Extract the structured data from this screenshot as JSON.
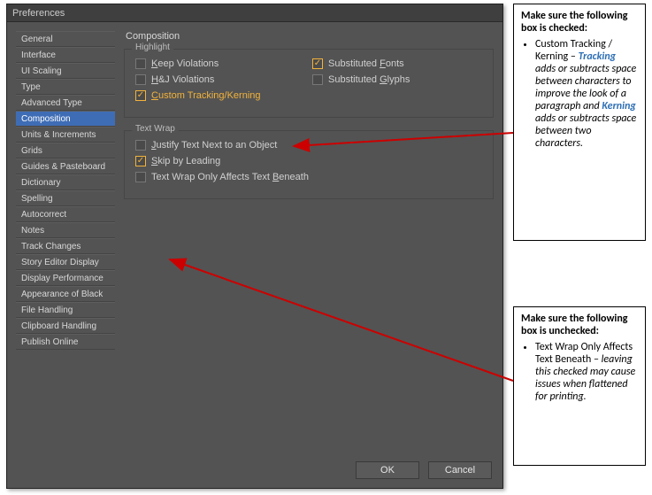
{
  "dialog": {
    "title": "Preferences",
    "sidebar": {
      "items": [
        "General",
        "Interface",
        "UI Scaling",
        "Type",
        "Advanced Type",
        "Composition",
        "Units & Increments",
        "Grids",
        "Guides & Pasteboard",
        "Dictionary",
        "Spelling",
        "Autocorrect",
        "Notes",
        "Track Changes",
        "Story Editor Display",
        "Display Performance",
        "Appearance of Black",
        "File Handling",
        "Clipboard Handling",
        "Publish Online"
      ],
      "selected": "Composition"
    },
    "content": {
      "heading": "Composition",
      "highlight": {
        "title": "Highlight",
        "keep_violations": "Keep Violations",
        "substituted_fonts": "Substituted Fonts",
        "hj_violations": "H&J Violations",
        "substituted_glyphs": "Substituted Glyphs",
        "custom_tracking": "Custom Tracking/Kerning"
      },
      "textwrap": {
        "title": "Text Wrap",
        "justify": "Justify Text Next to an Object",
        "skip": "Skip by Leading",
        "beneath": "Text Wrap Only Affects Text Beneath"
      }
    },
    "buttons": {
      "ok": "OK",
      "cancel": "Cancel"
    }
  },
  "annotations": {
    "box1": {
      "lead": "Make sure the following box is checked:",
      "item_pre": "Custom Tracking / Kerning – ",
      "term1": "Tracking",
      "mid1": " adds or subtracts space between characters to improve the look of a paragraph and ",
      "term2": "Kerning",
      "tail": " adds or subtracts space between two characters."
    },
    "box2": {
      "lead": "Make sure the following box is unchecked:",
      "item_pre": "Text Wrap Only Affects Text Beneath – ",
      "tail": "leaving this checked may cause issues when flattened for printing."
    }
  }
}
